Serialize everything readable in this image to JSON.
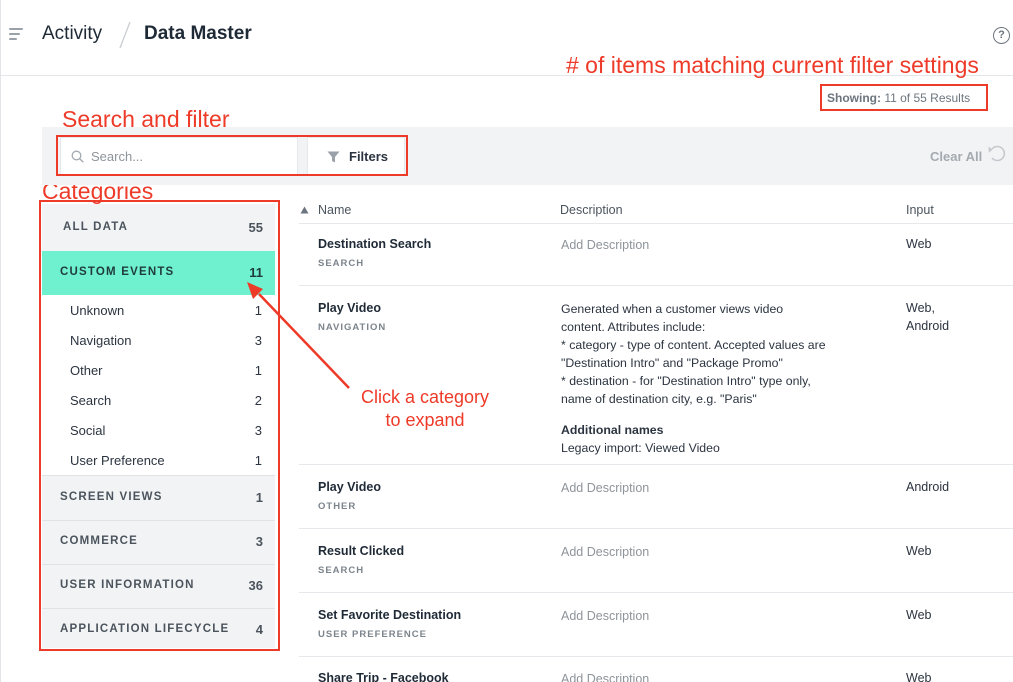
{
  "header": {
    "breadcrumb_parent": "Activity",
    "breadcrumb_current": "Data Master"
  },
  "annotations": {
    "matching": "# of items matching current filter settings",
    "search_filter": "Search and filter",
    "categories": "Categories",
    "click_line1": "Click a category",
    "click_line2": "to expand"
  },
  "showing": {
    "label": "Showing:",
    "value": "11 of 55 Results"
  },
  "toolbar": {
    "search_placeholder": "Search...",
    "filters_label": "Filters",
    "clear_all_label": "Clear All"
  },
  "categories": {
    "all": {
      "label": "ALL DATA",
      "count": "55"
    },
    "custom_events": {
      "label": "CUSTOM EVENTS",
      "count": "11"
    },
    "sub_items": [
      {
        "label": "Unknown",
        "count": "1"
      },
      {
        "label": "Navigation",
        "count": "3"
      },
      {
        "label": "Other",
        "count": "1"
      },
      {
        "label": "Search",
        "count": "2"
      },
      {
        "label": "Social",
        "count": "3"
      },
      {
        "label": "User Preference",
        "count": "1"
      }
    ],
    "screen_views": {
      "label": "SCREEN VIEWS",
      "count": "1"
    },
    "commerce": {
      "label": "COMMERCE",
      "count": "3"
    },
    "user_information": {
      "label": "USER INFORMATION",
      "count": "36"
    },
    "application_lifecycle": {
      "label": "APPLICATION LIFECYCLE",
      "count": "4"
    }
  },
  "table": {
    "columns": {
      "name": "Name",
      "description": "Description",
      "input": "Input"
    },
    "rows": [
      {
        "name": "Destination Search",
        "category": "SEARCH",
        "description": "Add Description",
        "input": "Web"
      },
      {
        "name": "Play Video",
        "category": "NAVIGATION",
        "description_lines": [
          "Generated when a customer views video",
          "content. Attributes include:",
          "* category - type of content. Accepted values are",
          "\"Destination Intro\" and \"Package Promo\"",
          "* destination - for \"Destination Intro\" type only,",
          "name of destination city, e.g. \"Paris\""
        ],
        "additional_names_heading": "Additional names",
        "additional_names_value": "Legacy import: Viewed Video",
        "input_line1": "Web,",
        "input_line2": "Android"
      },
      {
        "name": "Play Video",
        "category": "OTHER",
        "description": "Add Description",
        "input": "Android"
      },
      {
        "name": "Result Clicked",
        "category": "SEARCH",
        "description": "Add Description",
        "input": "Web"
      },
      {
        "name": "Set Favorite Destination",
        "category": "USER PREFERENCE",
        "description": "Add Description",
        "input": "Web"
      },
      {
        "name": "Share Trip - Facebook",
        "category": "",
        "description": "Add Description",
        "input": "Web"
      }
    ]
  },
  "colors": {
    "annotation_red": "#ee3a28",
    "selected_category": "#6ff0cf"
  }
}
